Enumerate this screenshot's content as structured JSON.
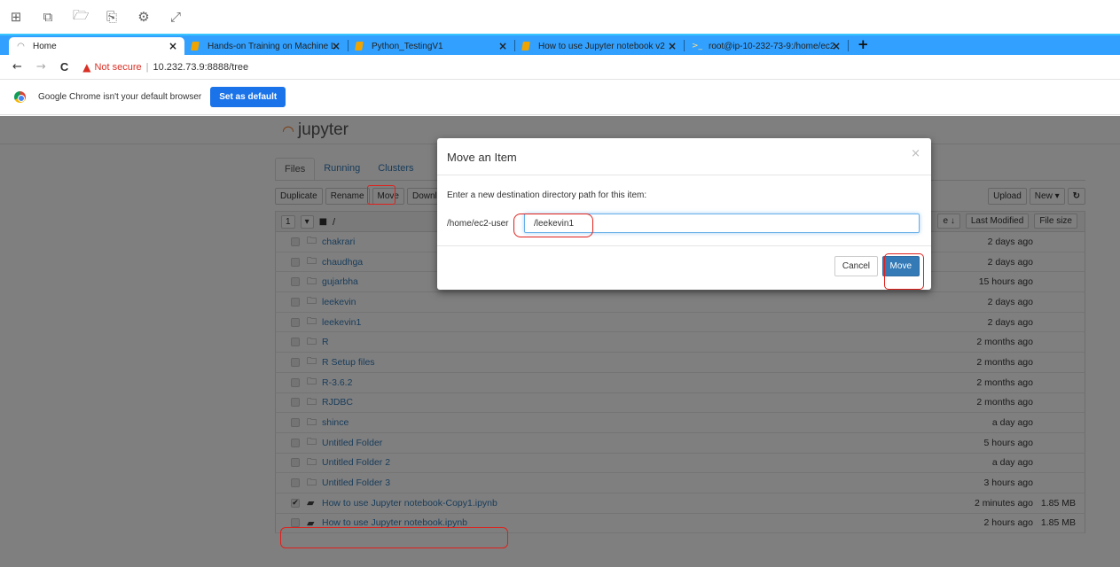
{
  "os_toolbar": {
    "icons": [
      "grid-icon",
      "window-icon",
      "folder-icon",
      "copy-icon",
      "settings-icon",
      "expand-icon"
    ],
    "glyphs": [
      "⊞",
      "⧉",
      "🗁",
      "⎘",
      "⚙",
      "⤢"
    ]
  },
  "browser": {
    "tabs": [
      {
        "title": "Home",
        "icon": "jupyter-icon",
        "close": "×"
      },
      {
        "title": "Hands-on Training on Machine L",
        "icon": "notebook-icon",
        "close": "×"
      },
      {
        "title": "Python_TestingV1",
        "icon": "notebook-icon",
        "close": "×"
      },
      {
        "title": "How to use Jupyter notebook v2",
        "icon": "notebook-icon",
        "close": "×"
      },
      {
        "title": "root@ip-10-232-73-9:/home/ec2",
        "icon": "terminal-icon",
        "close": "×"
      }
    ],
    "new_tab": "+",
    "nav": {
      "back": "←",
      "forward": "→",
      "reload": "C"
    },
    "security_label": "Not secure",
    "separator": "|",
    "url": "10.232.73.9:8888/tree"
  },
  "infobar": {
    "message": "Google Chrome isn't your default browser",
    "button": "Set as default"
  },
  "jupyter": {
    "logo_text": "jupyter",
    "tabs": [
      "Files",
      "Running",
      "Clusters"
    ],
    "actions": [
      "Duplicate",
      "Rename",
      "Move",
      "Download"
    ],
    "right_actions": {
      "upload": "Upload",
      "new": "New ▾",
      "refresh": "↻"
    },
    "header": {
      "count": "1",
      "caret": "▾",
      "root": "/",
      "name_sort": "e ↓",
      "last_modified": "Last Modified",
      "file_size": "File size"
    },
    "files": [
      {
        "name": "chakrari",
        "type": "folder",
        "modified": "2 days ago",
        "size": ""
      },
      {
        "name": "chaudhga",
        "type": "folder",
        "modified": "2 days ago",
        "size": ""
      },
      {
        "name": "gujarbha",
        "type": "folder",
        "modified": "15 hours ago",
        "size": ""
      },
      {
        "name": "leekevin",
        "type": "folder",
        "modified": "2 days ago",
        "size": ""
      },
      {
        "name": "leekevin1",
        "type": "folder",
        "modified": "2 days ago",
        "size": ""
      },
      {
        "name": "R",
        "type": "folder",
        "modified": "2 months ago",
        "size": ""
      },
      {
        "name": "R Setup files",
        "type": "folder",
        "modified": "2 months ago",
        "size": ""
      },
      {
        "name": "R-3.6.2",
        "type": "folder",
        "modified": "2 months ago",
        "size": ""
      },
      {
        "name": "RJDBC",
        "type": "folder",
        "modified": "2 months ago",
        "size": ""
      },
      {
        "name": "shince",
        "type": "folder",
        "modified": "a day ago",
        "size": ""
      },
      {
        "name": "Untitled Folder",
        "type": "folder",
        "modified": "5 hours ago",
        "size": ""
      },
      {
        "name": "Untitled Folder 2",
        "type": "folder",
        "modified": "a day ago",
        "size": ""
      },
      {
        "name": "Untitled Folder 3",
        "type": "folder",
        "modified": "3 hours ago",
        "size": ""
      },
      {
        "name": "How to use Jupyter notebook-Copy1.ipynb",
        "type": "notebook",
        "modified": "2 minutes ago",
        "size": "1.85 MB",
        "checked": true
      },
      {
        "name": "How to use Jupyter notebook.ipynb",
        "type": "notebook",
        "modified": "2 hours ago",
        "size": "1.85 MB"
      }
    ]
  },
  "modal": {
    "title": "Move an Item",
    "close": "×",
    "prompt": "Enter a new destination directory path for this item:",
    "path_prefix": "/home/ec2-user",
    "path_value": "/leekevin1",
    "cancel": "Cancel",
    "move": "Move"
  },
  "colors": {
    "tab_bar": "#31a0ff",
    "primary": "#337ab7",
    "annotation": "#e0201b",
    "warning": "#d93025"
  }
}
